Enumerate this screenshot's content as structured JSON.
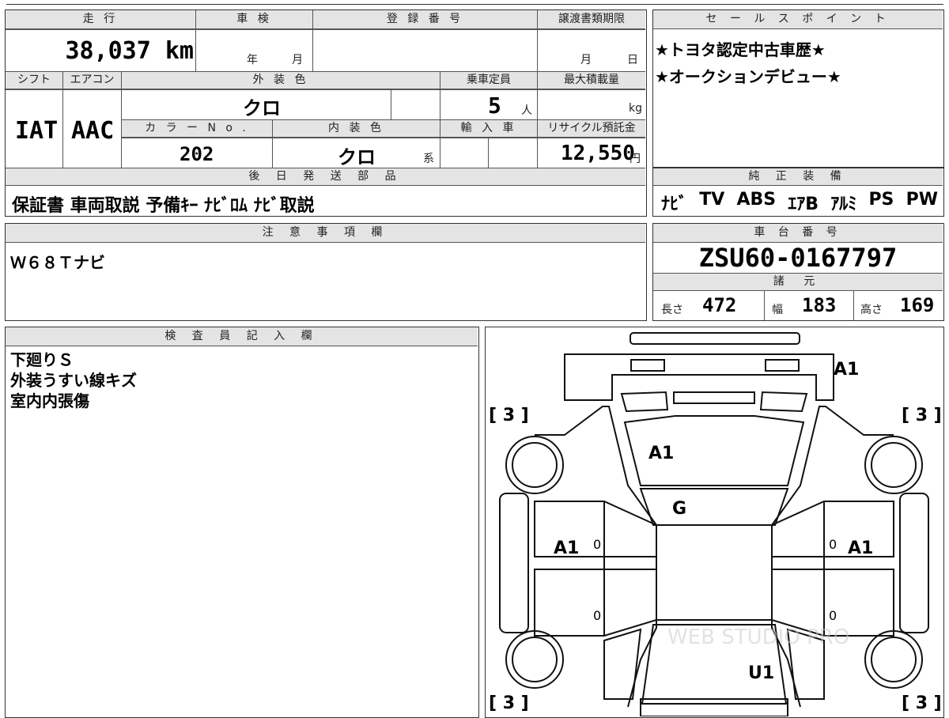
{
  "top_left": {
    "headers": {
      "mileage": "走 行",
      "inspection": "車 検",
      "registration": "登 録 番 号",
      "transfer_deadline": "譲渡書類期限"
    },
    "mileage": "38,037 km",
    "inspection_year": "年",
    "inspection_month": "月",
    "registration_number": "",
    "transfer_month": "月",
    "transfer_day": "日"
  },
  "spec": {
    "headers": {
      "shift": "シフト",
      "aircon": "エアコン",
      "exterior_color": "外 装 色",
      "capacity": "乗車定員",
      "max_load": "最大積載量",
      "color_no": "カ ラ ー N o .",
      "interior_color": "内 装 色",
      "import": "輸 入 車",
      "recycle": "リサイクル預託金"
    },
    "shift": "IAT",
    "aircon": "AAC",
    "exterior_color": "クロ",
    "capacity": "5",
    "capacity_unit": "人",
    "max_load_unit": "kg",
    "color_no": "202",
    "interior_color": "クロ",
    "interior_suffix": "系",
    "recycle_fee": "12,550",
    "recycle_unit": "円"
  },
  "later_parts": {
    "header": "後 日 発 送 部 品",
    "items": "保証書 車両取説 予備ｷｰ ﾅﾋﾞﾛﾑ ﾅﾋﾞ取説"
  },
  "sales_points": {
    "header": "セ ー ル ス ポ イ ン ト",
    "lines": [
      "★トヨタ認定中古車歴★",
      "★オークションデビュー★"
    ]
  },
  "genuine_equipment": {
    "header": "純 正 装 備",
    "items": [
      "ﾅﾋﾞ",
      "TV",
      "ABS",
      "ｴｱB",
      "ｱﾙﾐ",
      "PS",
      "PW"
    ]
  },
  "notes": {
    "header": "注 意 事 項 欄",
    "text": "Ｗ６８Ｔナビ"
  },
  "chassis": {
    "header": "車 台 番 号",
    "number": "ZSU60-0167797",
    "dims_header": "諸 元",
    "length_label": "長さ",
    "length": "472",
    "width_label": "幅",
    "width": "183",
    "height_label": "高さ",
    "height": "169"
  },
  "inspector": {
    "header": "検 査 員 記 入 欄",
    "lines": [
      "下廻りＳ",
      "外装うすい線キズ",
      "室内内張傷"
    ]
  },
  "diagram": {
    "marks": {
      "front_bumper": "A1",
      "hood": "A1",
      "windshield": "G",
      "left_door": "A1",
      "right_door": "A1",
      "rear": "U1",
      "tire_fl": "[ 3 ]",
      "tire_fr": "[ 3 ]",
      "tire_rl": "[ 3 ]",
      "tire_rr": "[ 3 ]",
      "small_zero": "0"
    },
    "watermark": "WEB STUDIO PRO"
  }
}
